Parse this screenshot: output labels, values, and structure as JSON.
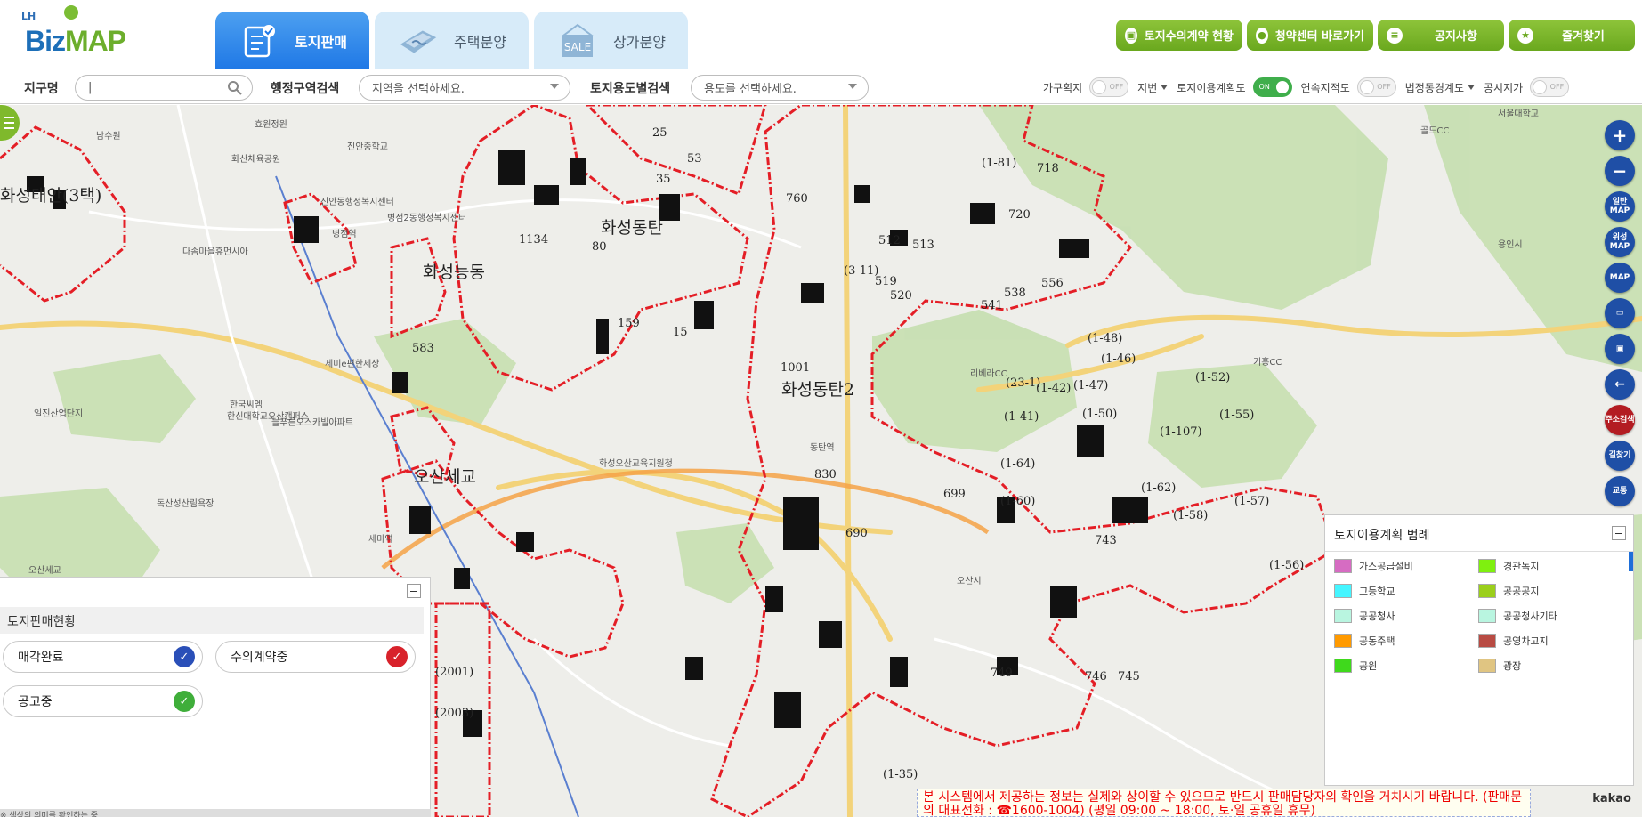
{
  "logo": {
    "lh": "LH",
    "biz": "Biz",
    "map": "MAP"
  },
  "main_tabs": [
    {
      "label": "토지판매",
      "icon": "checklist-icon",
      "active": true
    },
    {
      "label": "주택분양",
      "icon": "house-ticket-icon",
      "active": false
    },
    {
      "label": "상가분양",
      "icon": "sale-tag-icon",
      "active": false
    }
  ],
  "top_buttons": [
    {
      "label": "토지수의계약 현황",
      "icon": "truck-icon"
    },
    {
      "label": "청약센터 바로가기",
      "icon": "person-icon"
    },
    {
      "label": "공지사항",
      "icon": "note-icon"
    },
    {
      "label": "즐겨찾기",
      "icon": "star-icon"
    }
  ],
  "search": {
    "district_label": "지구명",
    "district_value": "|",
    "admin_label": "행정구역검색",
    "admin_value": "지역을 선택하세요.",
    "use_label": "토지용도별검색",
    "use_value": "용도를 선택하세요."
  },
  "toggles": [
    {
      "label": "가구획지",
      "state": "OFF"
    },
    {
      "label": "지번",
      "type": "dropdown"
    },
    {
      "label": "토지이용계획도",
      "state": "ON"
    },
    {
      "label": "연속지적도",
      "state": "OFF"
    },
    {
      "label": "법정동경계도",
      "type": "dropdown"
    },
    {
      "label": "공시지가",
      "state": "OFF"
    }
  ],
  "map_tools": [
    "+",
    "−",
    "일반MAP",
    "위성MAP",
    "MAP",
    "▭",
    "▣",
    "←",
    "주소검색",
    "길찾기",
    "교통"
  ],
  "map_labels": {
    "districts": [
      "화성태안(3택)",
      "화성능동",
      "화성동탄",
      "화성동탄2",
      "오산세교"
    ],
    "lots": [
      "25",
      "53",
      "35",
      "1134",
      "80",
      "159",
      "15",
      "583",
      "760",
      "512",
      "513",
      "519",
      "520",
      "(3-11)",
      "538",
      "541",
      "556",
      "(1-81)",
      "718",
      "720",
      "1001",
      "(23-1)",
      "(1-47)",
      "(1-48)",
      "(1-46)",
      "(1-42)",
      "(1-50)",
      "(1-41)",
      "(1-107)",
      "(1-52)",
      "(1-55)",
      "(1-64)",
      "(1-60)",
      "699",
      "690",
      "830",
      "(1-62)",
      "(1-58)",
      "(1-57)",
      "(1-56)",
      "743",
      "746",
      "745",
      "749",
      "(2001)",
      "(2003)",
      "(1-35)"
    ],
    "places": [
      "효원정원",
      "남수원",
      "화산체육공원",
      "진안중학교",
      "진안동행정복지센터",
      "병점2동행정복지센터",
      "병점역",
      "다솜마을휴먼시아",
      "한국씨엠",
      "일진산업단지",
      "한신대학교오산캠퍼스",
      "늘푸른오스카빌아파트",
      "세미e편한세상",
      "독산성산림욕장",
      "세마역",
      "오산세교",
      "서울대학교",
      "골드CC",
      "리베라CC",
      "기흥CC",
      "용인시",
      "화성오산교육지원청",
      "동탄역",
      "오산시"
    ]
  },
  "sales_panel": {
    "title": "토지판매현황",
    "items": [
      {
        "label": "매각완료",
        "color": "#2a4fb8"
      },
      {
        "label": "수의계약중",
        "color": "#d8222b"
      },
      {
        "label": "공고중",
        "color": "#3fae3a"
      }
    ],
    "footer": "※ 색상의 의미를 확인하는 중"
  },
  "legend": {
    "title": "토지이용계획 범례",
    "items": [
      {
        "label": "가스공급설비",
        "color": "#d66cc2"
      },
      {
        "label": "경관녹지",
        "color": "#7ff00f"
      },
      {
        "label": "고등학교",
        "color": "#45f5ff"
      },
      {
        "label": "공공공지",
        "color": "#9bcf1b"
      },
      {
        "label": "공공청사",
        "color": "#b9f5e0"
      },
      {
        "label": "공공청사기타",
        "color": "#b9f5e0"
      },
      {
        "label": "공동주택",
        "color": "#ff9a00"
      },
      {
        "label": "공영차고지",
        "color": "#b84b43"
      },
      {
        "label": "공원",
        "color": "#3fd91c"
      },
      {
        "label": "광장",
        "color": "#e0c582"
      }
    ]
  },
  "notice": "본 시스템에서 제공하는 정보는 실제와 상이할 수 있으므로 반드시 판매담당자의 확인을 거치시기 바랍니다. (판매문의 대표전화 : ☎1600-1004) (평일 09:00 ~ 18:00, 토·일 공휴일 휴무)",
  "kakao": "kakao"
}
